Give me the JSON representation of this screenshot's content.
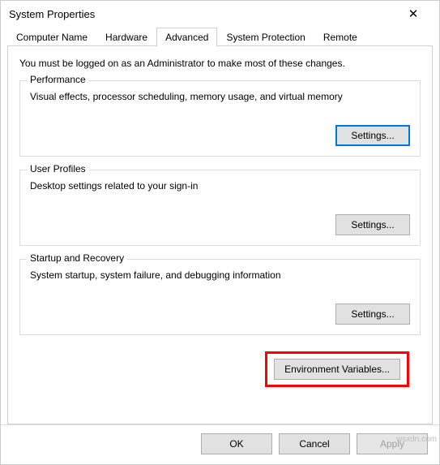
{
  "window": {
    "title": "System Properties",
    "close_icon": "✕"
  },
  "tabs": {
    "computer_name": "Computer Name",
    "hardware": "Hardware",
    "advanced": "Advanced",
    "system_protection": "System Protection",
    "remote": "Remote"
  },
  "advanced_panel": {
    "intro": "You must be logged on as an Administrator to make most of these changes.",
    "performance": {
      "legend": "Performance",
      "desc": "Visual effects, processor scheduling, memory usage, and virtual memory",
      "settings_label": "Settings..."
    },
    "user_profiles": {
      "legend": "User Profiles",
      "desc": "Desktop settings related to your sign-in",
      "settings_label": "Settings..."
    },
    "startup_recovery": {
      "legend": "Startup and Recovery",
      "desc": "System startup, system failure, and debugging information",
      "settings_label": "Settings..."
    },
    "env_vars_label": "Environment Variables..."
  },
  "footer": {
    "ok": "OK",
    "cancel": "Cancel",
    "apply": "Apply"
  },
  "watermark": "wsxdn.com"
}
